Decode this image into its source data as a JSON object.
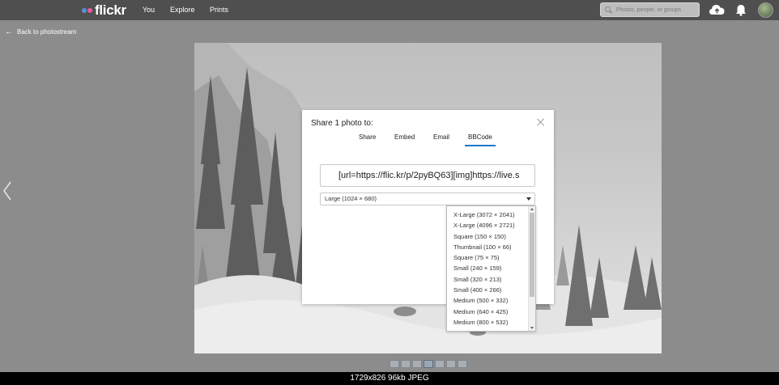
{
  "header": {
    "logo_text": "flickr",
    "nav": [
      "You",
      "Explore",
      "Prints"
    ],
    "search_placeholder": "Photos, people, or groups"
  },
  "back_link": "Back to photostream",
  "modal": {
    "title": "Share 1 photo to:",
    "tabs": [
      "Share",
      "Embed",
      "Email",
      "BBCode"
    ],
    "active_tab": "BBCode",
    "code_value": "[url=https://flic.kr/p/2pyBQ63][img]https://live.s",
    "selected_size": "Large (1024 × 680)"
  },
  "dropdown_options": [
    "X-Large (3072 × 2041)",
    "X-Large (4096 × 2721)",
    "Square (150 × 150)",
    "Thumbnail (100 × 66)",
    "Square (75 × 75)",
    "Small (240 × 159)",
    "Small (320 × 213)",
    "Small (400 × 266)",
    "Medium (500 × 332)",
    "Medium (640 × 425)",
    "Medium (800 × 532)"
  ],
  "caption": "1729x826 96kb JPEG",
  "colors": {
    "topbar": "#4f4f4f",
    "overlay_bg": "#8c8c8c",
    "accent": "#1c78c8"
  },
  "icons": [
    "upload-cloud-icon",
    "bell-icon",
    "search-icon",
    "close-icon",
    "chevron-left-icon",
    "back-arrow-icon"
  ]
}
